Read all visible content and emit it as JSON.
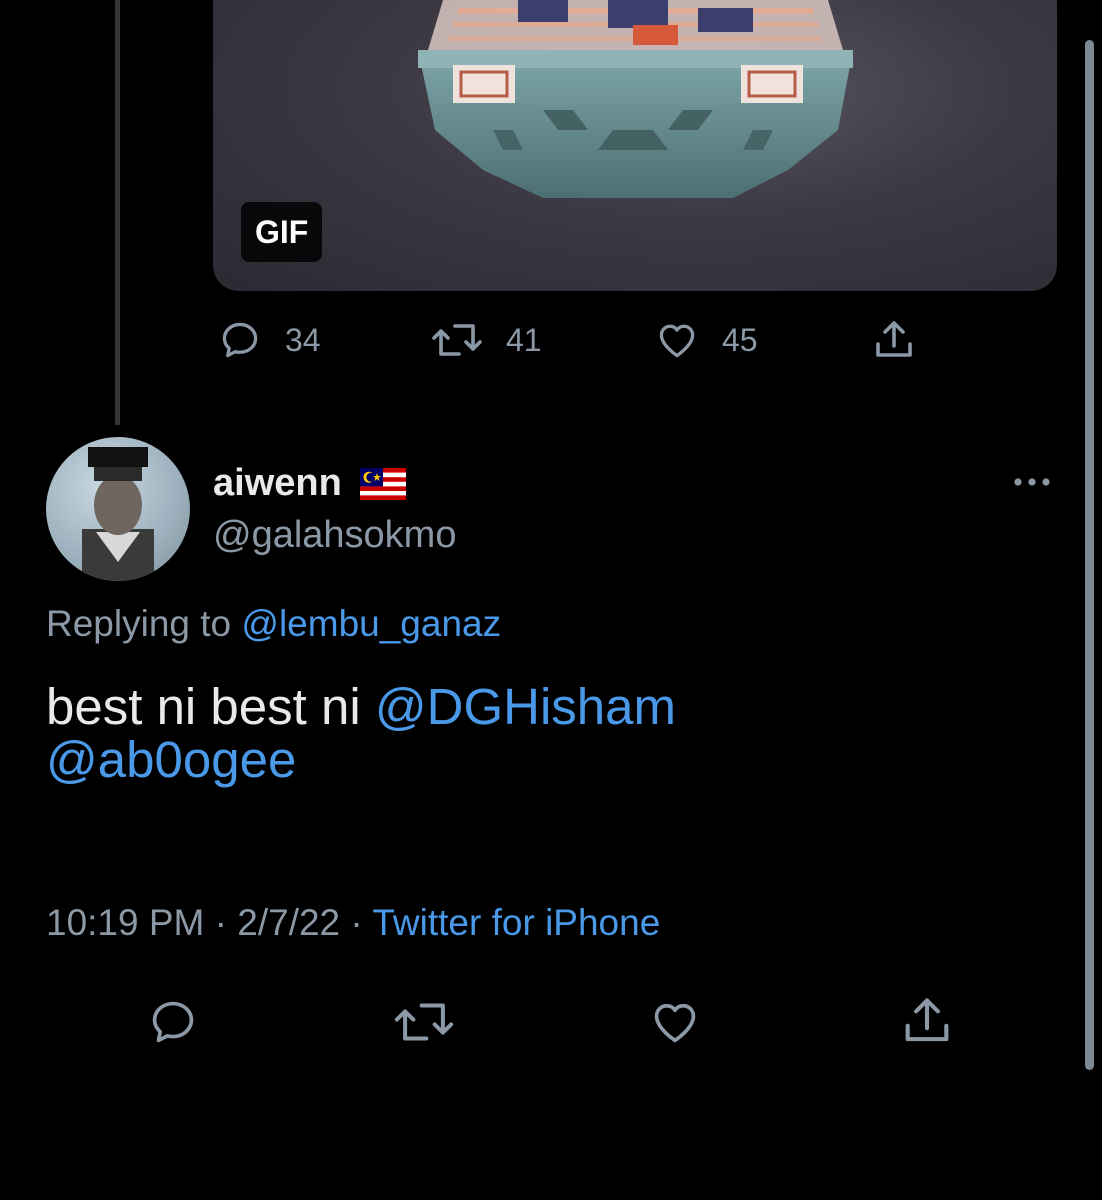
{
  "quoted_tweet": {
    "media_badge": "GIF",
    "actions": {
      "reply_count": "34",
      "retweet_count": "41",
      "like_count": "45"
    }
  },
  "reply": {
    "author": {
      "name": "aiwenn",
      "flag_icon": "malaysia-flag-icon",
      "handle": "@galahsokmo"
    },
    "replying_prefix": "Replying to",
    "replying_to": "@lembu_ganaz",
    "text_prefix": "best ni best ni",
    "mentions": [
      "@DGHisham",
      "@ab0ogee"
    ],
    "time": "10:19 PM",
    "separator": "·",
    "date": "2/7/22",
    "source": "Twitter for iPhone"
  },
  "icons": [
    "reply-icon",
    "retweet-icon",
    "like-icon",
    "share-icon",
    "more-options-icon"
  ],
  "colors": {
    "background": "#000000",
    "primary_text": "#e7e9ea",
    "secondary_text": "#8b98a5",
    "link": "#4a99e9"
  }
}
